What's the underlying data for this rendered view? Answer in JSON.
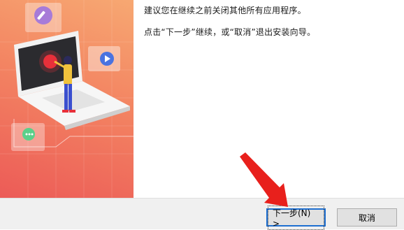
{
  "content": {
    "line1": "建议您在继续之前关闭其他所有应用程序。",
    "line2": "点击“下一步”继续，或“取消”退出安装向导。"
  },
  "buttons": {
    "next_label": "下一步(N) >",
    "cancel_label": "取消"
  },
  "colors": {
    "banner_top": "#f7a872",
    "banner_bottom": "#ec5b57",
    "focus_border": "#1e6fd1",
    "arrow": "#e8201c"
  }
}
